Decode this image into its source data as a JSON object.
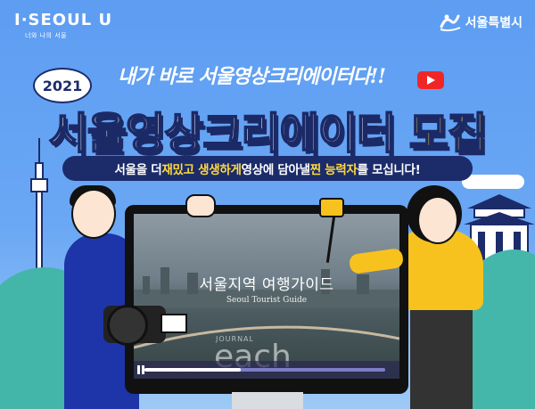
{
  "header": {
    "brand_left": "I·SEOUL U",
    "brand_left_sub": "너와 나의 서울",
    "brand_right": "서울특별시"
  },
  "hero": {
    "year": "2021",
    "tagline": "내가 바로 서울영상크리에이터다!!",
    "title_part1": "서울영상크리에이터",
    "title_part2": "모집",
    "subtitle_part1": "서울을 더 ",
    "subtitle_highlight1": "재밌고 생생하게",
    "subtitle_part2": " 영상에 담아낼 ",
    "subtitle_highlight2": "찐 능력자",
    "subtitle_part3": "를 모십니다!"
  },
  "video": {
    "title": "서울지역 여행가이드",
    "subtitle": "Seoul Tourist Guide",
    "watermark": "each",
    "watermark_small": "JOURNAL",
    "progress": 0.4
  },
  "colors": {
    "background": "#5d9df2",
    "navy": "#1c2c6b",
    "accent_yellow": "#ffd93b",
    "youtube_red": "#f02626",
    "hill_green": "#43b6a9"
  },
  "icons": [
    "youtube-play-icon",
    "seoul-city-logo-icon",
    "namsan-tower-icon",
    "palace-icon",
    "video-camera-icon",
    "selfie-stick-icon"
  ]
}
